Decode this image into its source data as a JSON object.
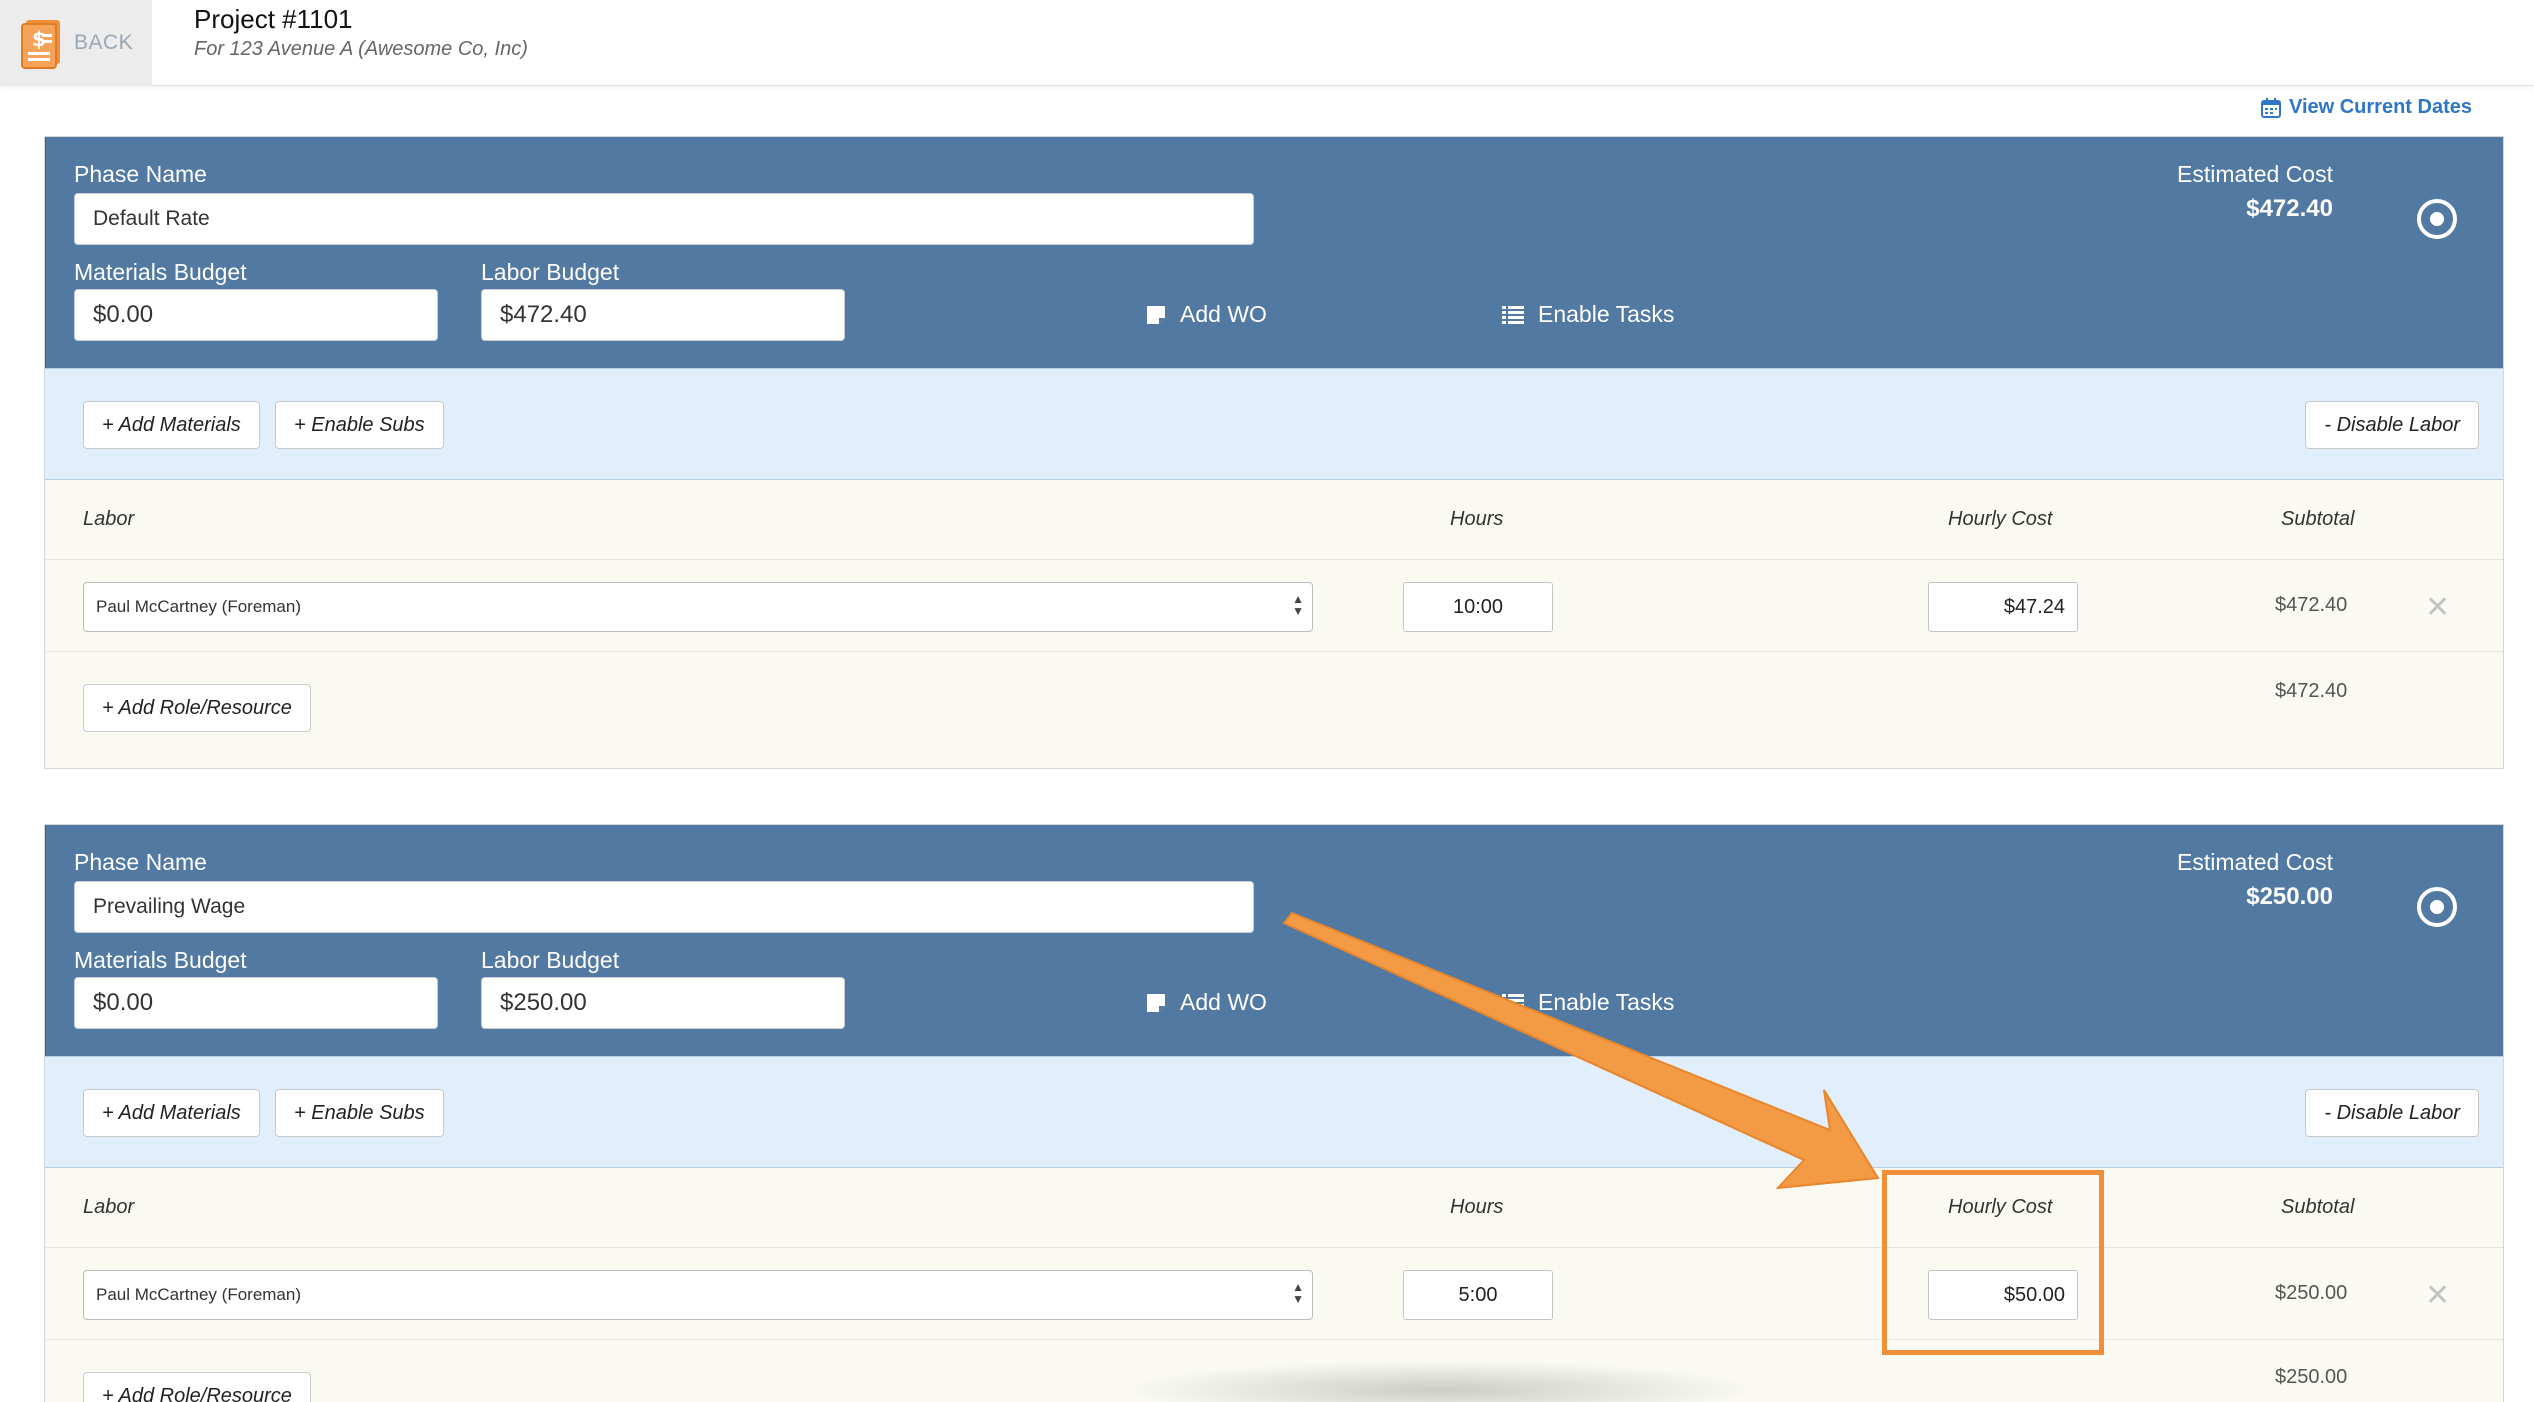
{
  "header": {
    "back_label": "BACK",
    "title": "Project #1101",
    "subtitle": "For 123 Avenue A (Awesome Co, Inc)"
  },
  "view_dates_label": "View Current Dates",
  "labels": {
    "phase_name": "Phase Name",
    "materials_budget": "Materials Budget",
    "labor_budget": "Labor Budget",
    "add_wo": "Add WO",
    "enable_tasks": "Enable Tasks",
    "estimated_cost": "Estimated Cost",
    "add_materials": "+ Add Materials",
    "enable_subs": "+ Enable Subs",
    "disable_labor": "- Disable Labor",
    "col_labor": "Labor",
    "col_hours": "Hours",
    "col_hourly": "Hourly Cost",
    "col_subtotal": "Subtotal",
    "add_role": "+ Add Role/Resource"
  },
  "phases": [
    {
      "name": "Default Rate",
      "materials_budget": "$0.00",
      "labor_budget": "$472.40",
      "estimated_cost": "$472.40",
      "labor_rows": [
        {
          "resource": "Paul McCartney (Foreman)",
          "hours": "10:00",
          "hourly_cost": "$47.24",
          "subtotal": "$472.40"
        }
      ],
      "total": "$472.40"
    },
    {
      "name": "Prevailing Wage",
      "materials_budget": "$0.00",
      "labor_budget": "$250.00",
      "estimated_cost": "$250.00",
      "labor_rows": [
        {
          "resource": "Paul McCartney (Foreman)",
          "hours": "5:00",
          "hourly_cost": "$50.00",
          "subtotal": "$250.00"
        }
      ],
      "total": "$250.00"
    }
  ],
  "icons": {
    "back": "invoice-dollar-icon",
    "calendar": "calendar-icon",
    "add_wo": "note-icon",
    "tasks": "list-icon",
    "target": "target-icon",
    "delete": "close-icon"
  },
  "colors": {
    "phase_header": "#5279a1",
    "toolbar": "#e1effc",
    "annotation": "#f08f3a",
    "link": "#2e77c7"
  }
}
